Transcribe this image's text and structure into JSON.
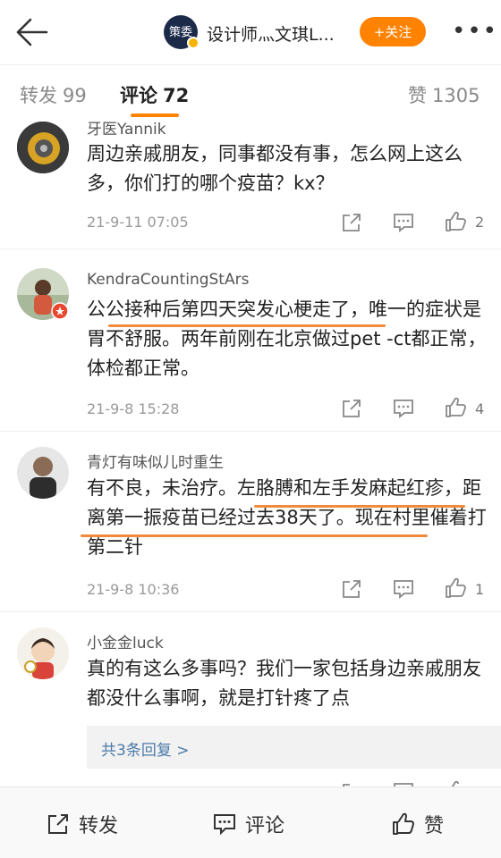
{
  "header": {
    "avatar_text": "策委",
    "title": "设计师灬文琪L...",
    "follow_label": "+关注"
  },
  "tabs": [
    {
      "label": "转发",
      "count": "99"
    },
    {
      "label": "评论",
      "count": "72"
    },
    {
      "label": "赞",
      "count": "1305"
    }
  ],
  "comments": [
    {
      "user": "牙医Yannik",
      "text": "周边亲戚朋友，同事都没有事，怎么网上这么多，你们打的哪个疫苗？kx？",
      "time": "21-9-11 07:05",
      "likes": "2"
    },
    {
      "user": "KendraCountingStArs",
      "text": "公公接种后第四天突发心梗走了，唯一的症状是胃不舒服。两年前刚在北京做过pet -ct都正常，体检都正常。",
      "time": "21-9-8 15:28",
      "likes": "4"
    },
    {
      "user": "青灯有味似儿时重生",
      "text": "有不良，未治疗。左胳膊和左手发麻起红疹，距离第一振疫苗已经过去38天了。现在村里催着打第二针",
      "time": "21-9-8 10:36",
      "likes": "1"
    },
    {
      "user": "小金金luck",
      "text": "真的有这么多事吗？我们一家包括身边亲戚朋友都没什么事啊，就是打针疼了点",
      "reply_link": "共3条回复 >"
    }
  ],
  "bottom": {
    "repost_label": "转发",
    "comment_label": "评论",
    "like_label": "赞"
  },
  "colors": {
    "accent": "#ff8200",
    "underline": "#f08a3c",
    "link": "#4b7aa8"
  },
  "icons": [
    "back-arrow-icon",
    "more-icon",
    "share-icon",
    "comment-icon",
    "like-icon"
  ]
}
